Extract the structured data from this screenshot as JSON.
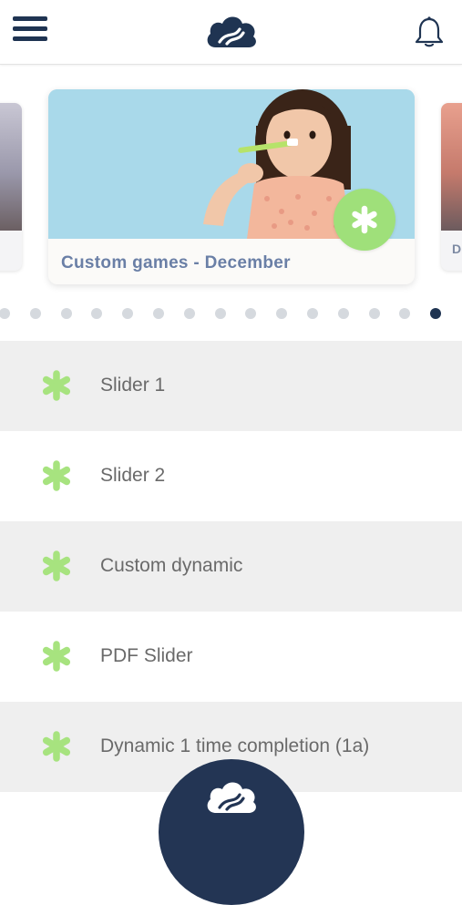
{
  "header": {
    "menu_icon": "hamburger-menu-icon",
    "logo_icon": "cloud-logo-icon",
    "notification_icon": "bell-icon"
  },
  "carousel": {
    "cards": [
      {
        "title": "",
        "image": "mountain-photo"
      },
      {
        "title": "Custom games - December",
        "image": "child-brushing-teeth-photo",
        "badge_icon": "asterisk-icon"
      },
      {
        "title": "D",
        "image": "mountain-photo"
      }
    ],
    "dot_count": 15,
    "active_dot_index": 14
  },
  "list": {
    "items": [
      {
        "label": "Slider 1",
        "icon": "asterisk-icon"
      },
      {
        "label": "Slider 2",
        "icon": "asterisk-icon"
      },
      {
        "label": "Custom dynamic",
        "icon": "asterisk-icon"
      },
      {
        "label": "PDF Slider",
        "icon": "asterisk-icon"
      },
      {
        "label": "Dynamic 1 time completion (1a)",
        "icon": "asterisk-icon"
      }
    ]
  },
  "fab": {
    "icon": "cloud-logo-icon"
  },
  "colors": {
    "navy": "#1f3452",
    "accent_green": "#9fe07a",
    "title_blue": "#6a7fa6",
    "row_shade": "#efefef",
    "text_gray": "#6a6a6a"
  }
}
